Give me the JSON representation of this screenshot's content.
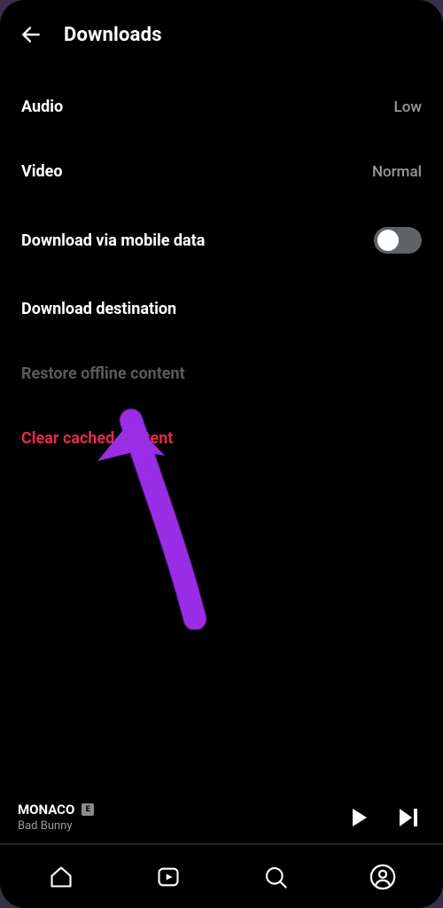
{
  "header": {
    "title": "Downloads"
  },
  "settings": {
    "audio": {
      "label": "Audio",
      "value": "Low"
    },
    "video": {
      "label": "Video",
      "value": "Normal"
    },
    "mobileData": {
      "label": "Download via mobile data"
    },
    "destination": {
      "label": "Download destination"
    },
    "restore": {
      "label": "Restore offline content"
    },
    "clearCache": {
      "label": "Clear cached content"
    }
  },
  "nowPlaying": {
    "title": "MONACO",
    "explicit": "E",
    "artist": "Bad Bunny"
  },
  "colors": {
    "danger": "#e6284f",
    "annotation": "#9a2fe6"
  }
}
